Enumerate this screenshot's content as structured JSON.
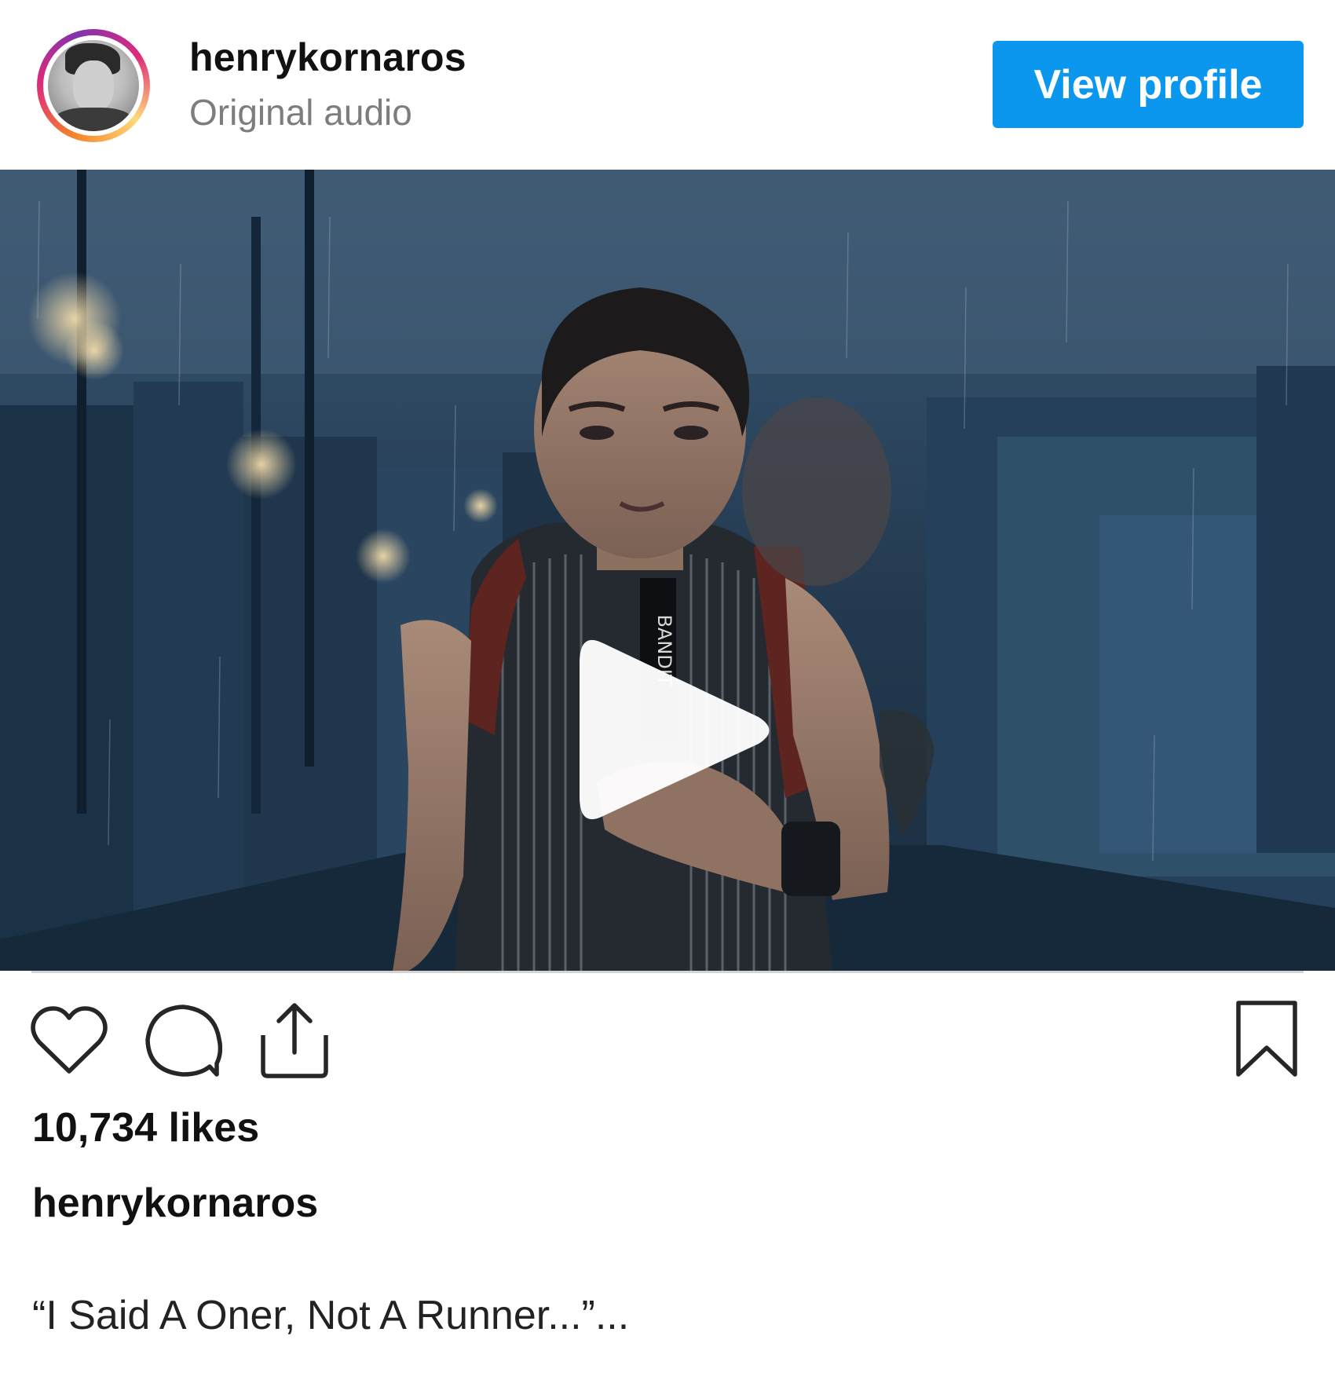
{
  "header": {
    "username": "henrykornaros",
    "subtitle": "Original audio",
    "view_profile_label": "View profile"
  },
  "media": {
    "type": "video",
    "play_icon": "play-icon",
    "shirt_text": "BANDIT"
  },
  "actions": {
    "icons": [
      "heart-icon",
      "comment-icon",
      "share-icon",
      "bookmark-icon"
    ]
  },
  "post": {
    "likes": "10,734 likes",
    "caption_username": "henrykornaros",
    "caption_text": "“I Said A Oner, Not A Runner...”..."
  },
  "colors": {
    "accent": "#0c97ef",
    "secondary_text": "#7d7d7d"
  }
}
